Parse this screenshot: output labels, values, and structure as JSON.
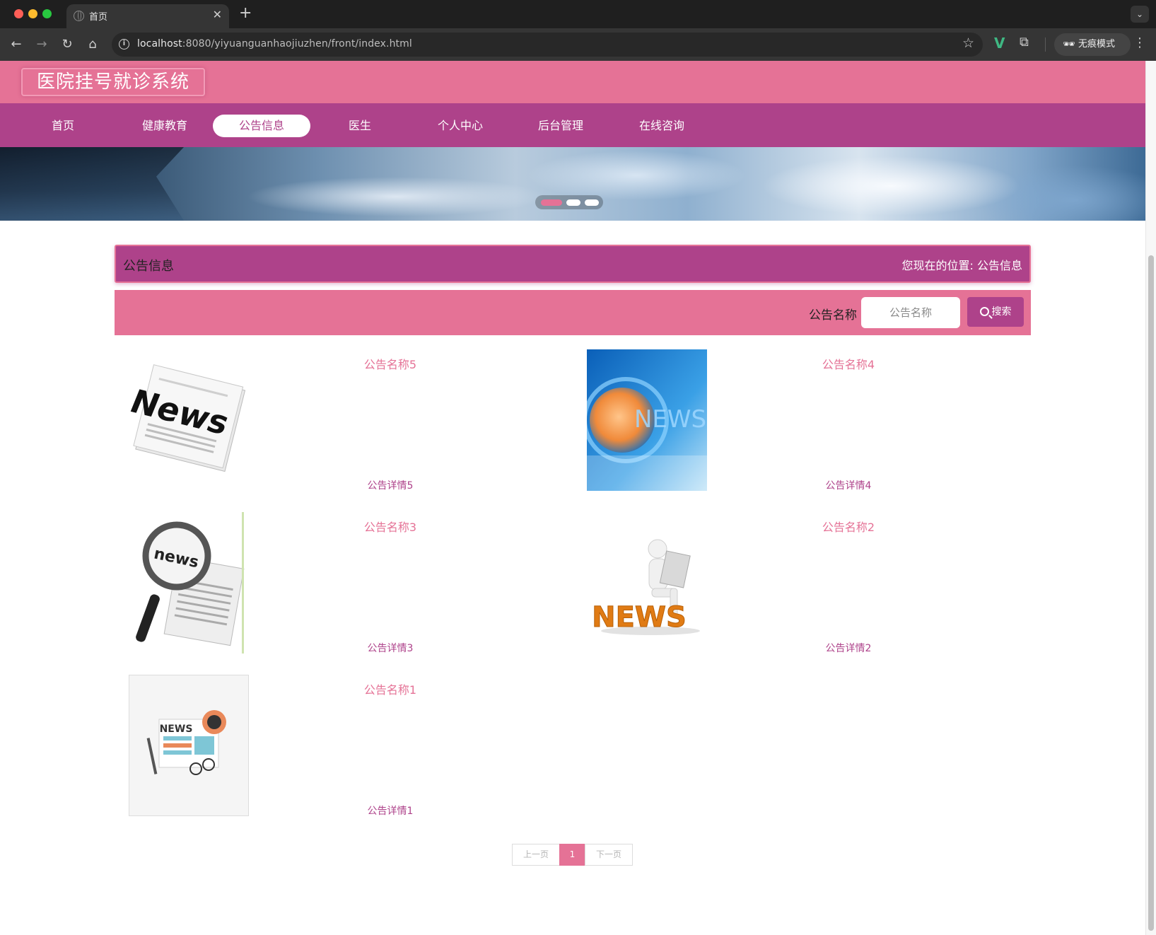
{
  "browser": {
    "tab_title": "首页",
    "url_host": "localhost",
    "url_rest": ":8080/yiyuanguanhaojiuzhen/front/index.html",
    "incognito_label": "无痕模式"
  },
  "site": {
    "brand": "医院挂号就诊系统",
    "nav": [
      "首页",
      "健康教育",
      "公告信息",
      "医生",
      "个人中心",
      "后台管理",
      "在线咨询"
    ],
    "active_nav": "公告信息"
  },
  "section": {
    "title": "公告信息",
    "breadcrumb_prefix": "您现在的位置:",
    "breadcrumb_current": "公告信息"
  },
  "search": {
    "label": "公告名称",
    "placeholder": "公告名称",
    "button": "搜索"
  },
  "notices": [
    {
      "name": "公告名称5",
      "detail": "公告详情5",
      "image": "newspaper-news-icon"
    },
    {
      "name": "公告名称4",
      "detail": "公告详情4",
      "image": "globe-news-broadcast-icon"
    },
    {
      "name": "公告名称3",
      "detail": "公告详情3",
      "image": "magnifier-news-icon"
    },
    {
      "name": "公告名称2",
      "detail": "公告详情2",
      "image": "figure-reading-news-icon"
    },
    {
      "name": "公告名称1",
      "detail": "公告详情1",
      "image": "flat-news-illustration-icon"
    }
  ],
  "pagination": {
    "prev": "上一页",
    "current": "1",
    "next": "下一页"
  },
  "colors": {
    "pink": "#e57296",
    "magenta": "#ae428a"
  }
}
